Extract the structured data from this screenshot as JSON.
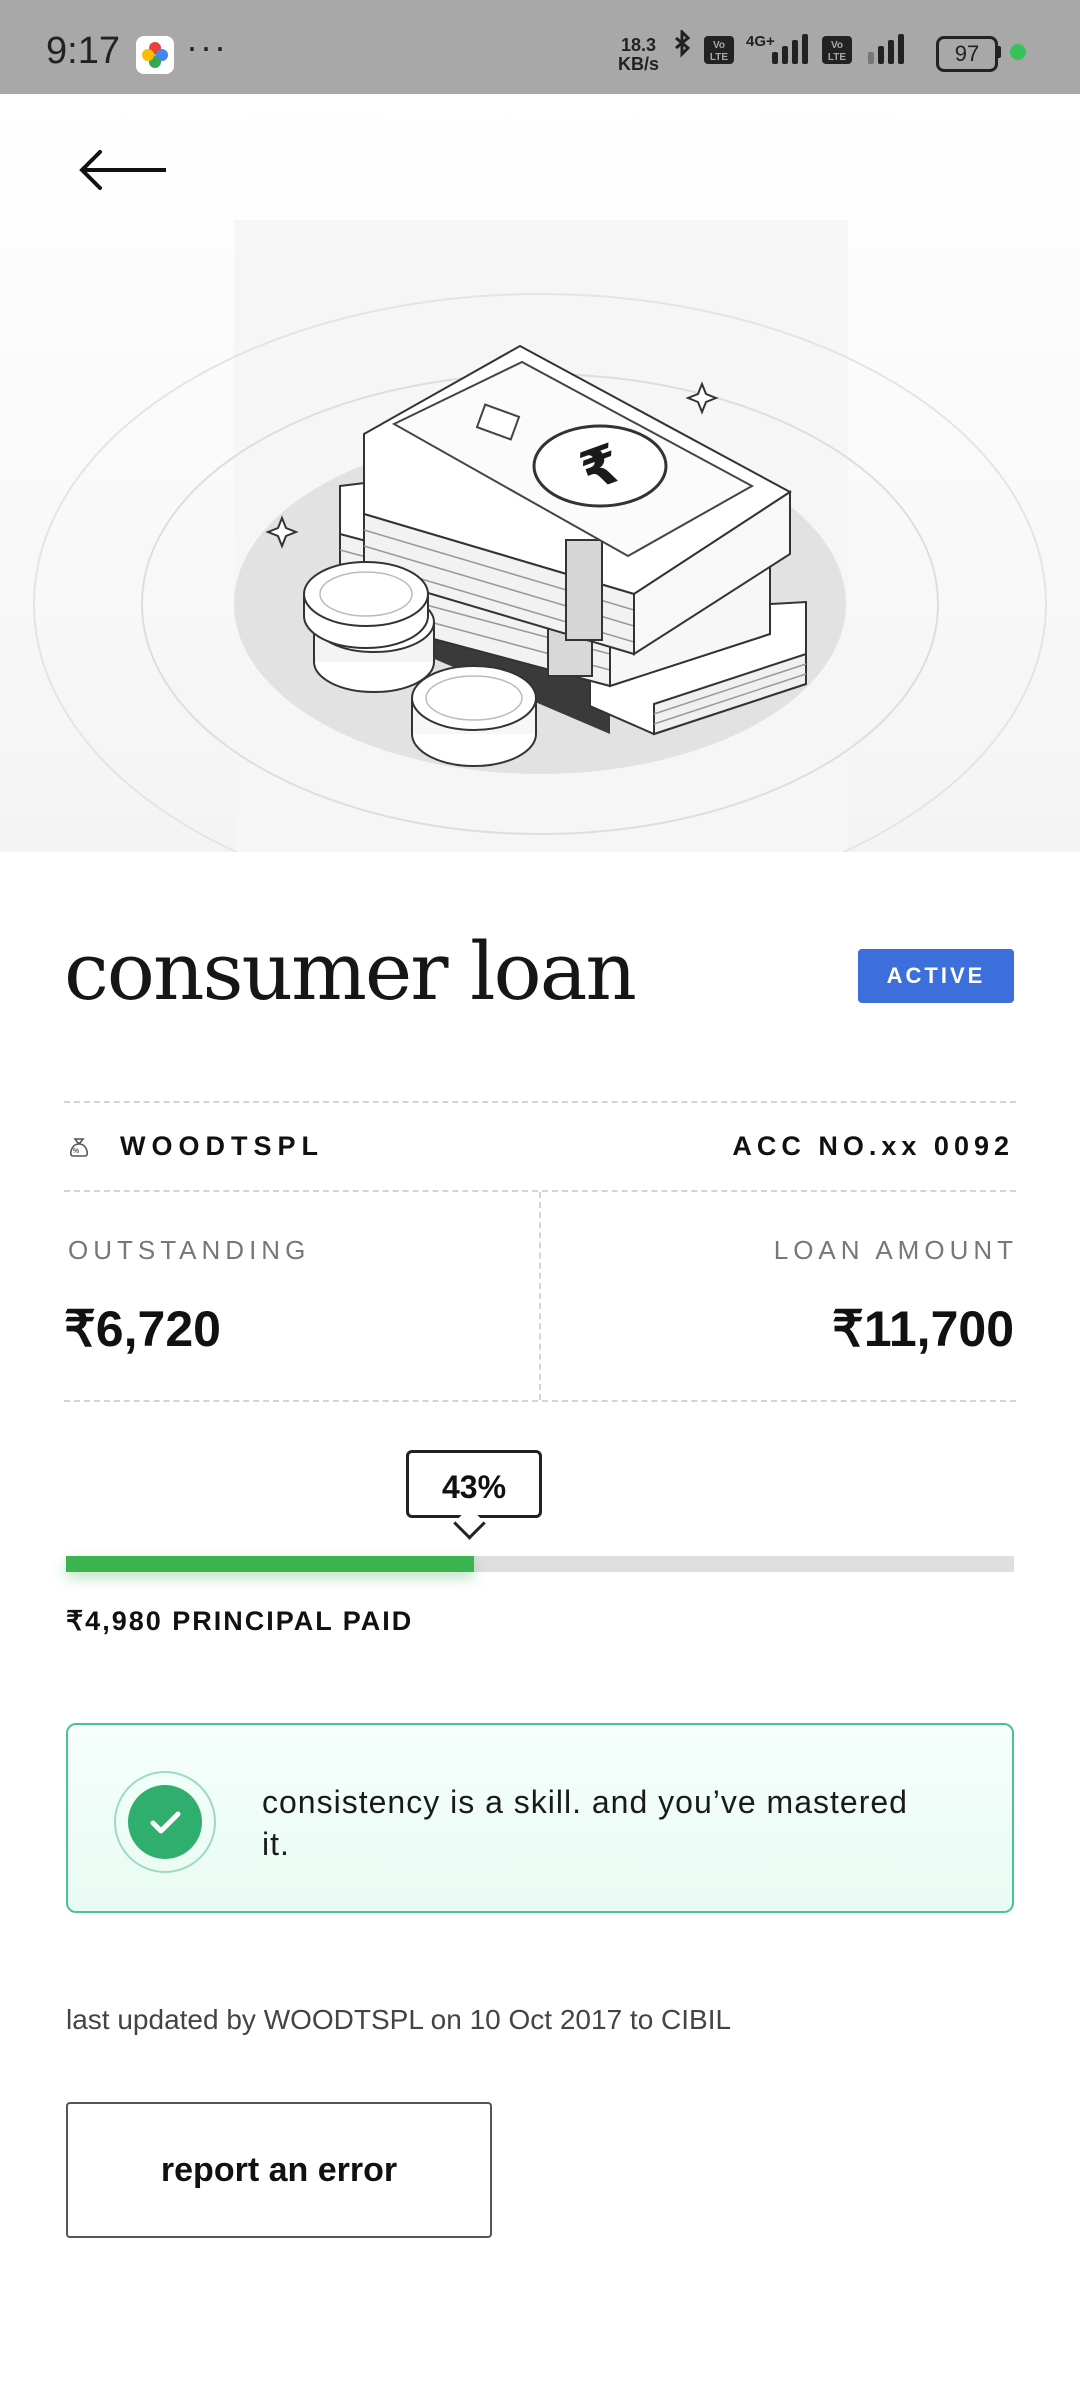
{
  "status_bar": {
    "time": "9:17",
    "dots": "···",
    "net_speed_value": "18.3",
    "net_speed_unit": "KB/s",
    "battery": "97"
  },
  "header": {
    "back_icon": "back-arrow-icon"
  },
  "hero": {
    "illustration": "rupee-notes-and-coins-illustration"
  },
  "loan": {
    "title": "consumer loan",
    "status": "ACTIVE",
    "lender": "WOODTSPL",
    "account": "ACC NO.xx 0092",
    "outstanding_label": "OUTSTANDING",
    "outstanding_value": "₹6,720",
    "loan_amount_label": "LOAN AMOUNT",
    "loan_amount_value": "₹11,700"
  },
  "progress": {
    "percent_label": "43%",
    "fraction": 0.43,
    "principal_paid": "₹4,980 PRINCIPAL PAID",
    "fill_color": "#3bb34f"
  },
  "message": {
    "text": "consistency is a skill. and you’ve mastered it."
  },
  "footer": {
    "updated_text": "last updated by WOODTSPL on 10 Oct 2017 to CIBIL",
    "report_button": "report an error"
  },
  "colors": {
    "badge": "#3d6fdc",
    "card_border": "#49c29a",
    "check": "#2fae6e"
  }
}
